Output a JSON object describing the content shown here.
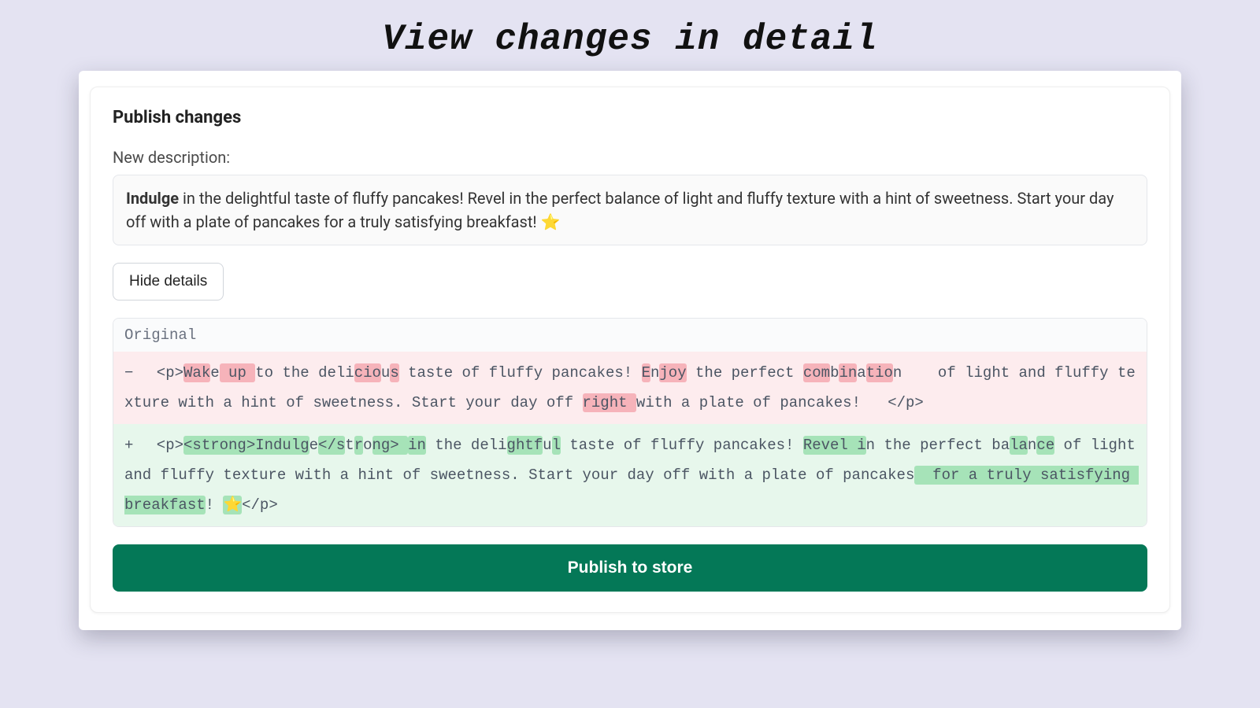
{
  "page_title": "View changes in detail",
  "card": {
    "title": "Publish changes",
    "field_label": "New description:",
    "description": {
      "strong": "Indulge",
      "rest": " in the delightful taste of fluffy pancakes! Revel in the perfect balance of light and fluffy texture with a hint of sweetness. Start your day off with a plate of pancakes for a truly satisfying breakfast! ⭐"
    },
    "hide_details_label": "Hide details",
    "diff": {
      "header_label": "Original",
      "removed": {
        "sign": "−",
        "tokens": [
          {
            "t": "  <p>",
            "m": 0
          },
          {
            "t": "Wak",
            "m": 1
          },
          {
            "t": "e",
            "m": 0
          },
          {
            "t": " up ",
            "m": 1
          },
          {
            "t": "t",
            "m": 0
          },
          {
            "t": "o the deli",
            "m": 0
          },
          {
            "t": "cio",
            "m": 1
          },
          {
            "t": "u",
            "m": 0
          },
          {
            "t": "s",
            "m": 1
          },
          {
            "t": " taste of fluffy pancakes! ",
            "m": 0
          },
          {
            "t": "E",
            "m": 1
          },
          {
            "t": "n",
            "m": 0
          },
          {
            "t": "joy",
            "m": 1
          },
          {
            "t": " the perfect ",
            "m": 0
          },
          {
            "t": "com",
            "m": 1
          },
          {
            "t": "b",
            "m": 0
          },
          {
            "t": "in",
            "m": 1
          },
          {
            "t": "a",
            "m": 0
          },
          {
            "t": "tio",
            "m": 1
          },
          {
            "t": "n    of light and fluffy texture with a hint of sweetness. Start your day off ",
            "m": 0
          },
          {
            "t": "right ",
            "m": 1
          },
          {
            "t": "with a plate of pancakes",
            "m": 0
          },
          {
            "t": "!",
            "m": 0
          },
          {
            "t": "   </p>",
            "m": 0
          }
        ]
      },
      "added": {
        "sign": "+",
        "tokens": [
          {
            "t": "  <p>",
            "m": 0
          },
          {
            "t": "<strong>Indulg",
            "m": 1
          },
          {
            "t": "e",
            "m": 0
          },
          {
            "t": "</s",
            "m": 1
          },
          {
            "t": "t",
            "m": 0
          },
          {
            "t": "r",
            "m": 1
          },
          {
            "t": "o",
            "m": 0
          },
          {
            "t": "ng> ",
            "m": 1
          },
          {
            "t": "in",
            "m": 1
          },
          {
            "t": " the deli",
            "m": 0
          },
          {
            "t": "ghtf",
            "m": 1
          },
          {
            "t": "u",
            "m": 0
          },
          {
            "t": "l",
            "m": 1
          },
          {
            "t": " taste of fluffy pancakes! ",
            "m": 0
          },
          {
            "t": "Revel i",
            "m": 1
          },
          {
            "t": "n",
            "m": 0
          },
          {
            "t": " the perfect ",
            "m": 0
          },
          {
            "t": "b",
            "m": 0
          },
          {
            "t": "a",
            "m": 0
          },
          {
            "t": "la",
            "m": 1
          },
          {
            "t": "n",
            "m": 0
          },
          {
            "t": "ce",
            "m": 1
          },
          {
            "t": " of light and fluffy texture with a hint of sweetness. Start your day off ",
            "m": 0
          },
          {
            "t": "with a plate of pancakes",
            "m": 0
          },
          {
            "t": "  for a truly satisfying breakfast",
            "m": 1
          },
          {
            "t": "!",
            "m": 0
          },
          {
            "t": " ",
            "m": 0
          },
          {
            "t": "⭐",
            "m": 1
          },
          {
            "t": "</p>",
            "m": 0
          }
        ]
      }
    },
    "publish_label": "Publish to store"
  }
}
